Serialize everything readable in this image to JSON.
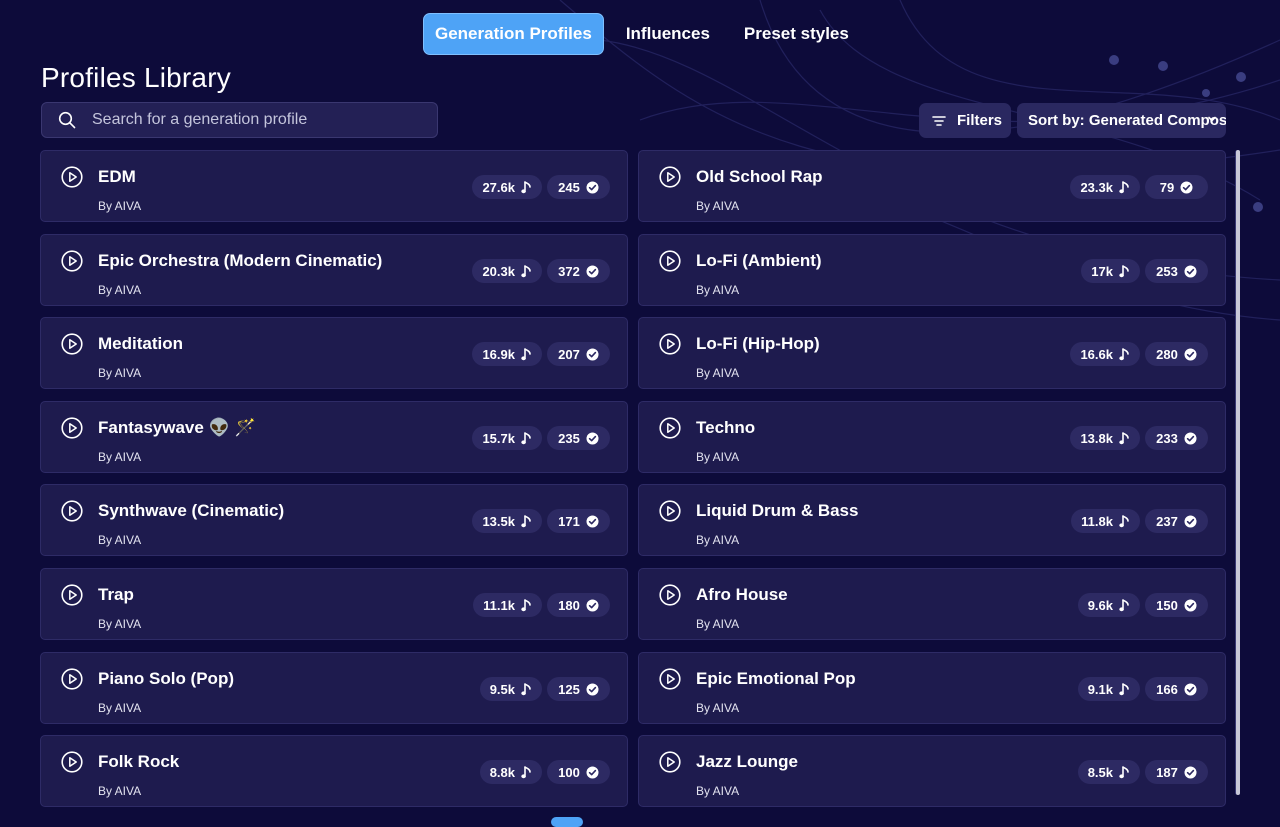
{
  "tabs": [
    {
      "label": "Generation Profiles",
      "active": true
    },
    {
      "label": "Influences",
      "active": false
    },
    {
      "label": "Preset styles",
      "active": false
    }
  ],
  "page": {
    "title": "Profiles Library"
  },
  "search": {
    "placeholder": "Search for a generation profile",
    "icon": "search-icon"
  },
  "toolbar": {
    "filters_label": "Filters",
    "sort_label": "Sort by: Generated Composit"
  },
  "profiles": [
    {
      "name": "EDM",
      "author": "By AIVA",
      "plays": "27.6k",
      "count": "245"
    },
    {
      "name": "Old School Rap",
      "author": "By AIVA",
      "plays": "23.3k",
      "count": "79"
    },
    {
      "name": "Epic Orchestra (Modern Cinematic)",
      "author": "By AIVA",
      "plays": "20.3k",
      "count": "372"
    },
    {
      "name": "Lo-Fi (Ambient)",
      "author": "By AIVA",
      "plays": "17k",
      "count": "253"
    },
    {
      "name": "Meditation",
      "author": "By AIVA",
      "plays": "16.9k",
      "count": "207"
    },
    {
      "name": "Lo-Fi (Hip-Hop)",
      "author": "By AIVA",
      "plays": "16.6k",
      "count": "280"
    },
    {
      "name": "Fantasywave 👽 🪄",
      "author": "By AIVA",
      "plays": "15.7k",
      "count": "235"
    },
    {
      "name": "Techno",
      "author": "By AIVA",
      "plays": "13.8k",
      "count": "233"
    },
    {
      "name": "Synthwave (Cinematic)",
      "author": "By AIVA",
      "plays": "13.5k",
      "count": "171"
    },
    {
      "name": "Liquid Drum & Bass",
      "author": "By AIVA",
      "plays": "11.8k",
      "count": "237"
    },
    {
      "name": "Trap",
      "author": "By AIVA",
      "plays": "11.1k",
      "count": "180"
    },
    {
      "name": "Afro House",
      "author": "By AIVA",
      "plays": "9.6k",
      "count": "150"
    },
    {
      "name": "Piano Solo (Pop)",
      "author": "By AIVA",
      "plays": "9.5k",
      "count": "125"
    },
    {
      "name": "Epic Emotional Pop",
      "author": "By AIVA",
      "plays": "9.1k",
      "count": "166"
    },
    {
      "name": "Folk Rock",
      "author": "By AIVA",
      "plays": "8.8k",
      "count": "100"
    },
    {
      "name": "Jazz Lounge",
      "author": "By AIVA",
      "plays": "8.5k",
      "count": "187"
    }
  ],
  "colors": {
    "background": "#0d0b3a",
    "card": "#1e1b4e",
    "accent": "#4ea3f6",
    "pill": "#2d2a63"
  }
}
